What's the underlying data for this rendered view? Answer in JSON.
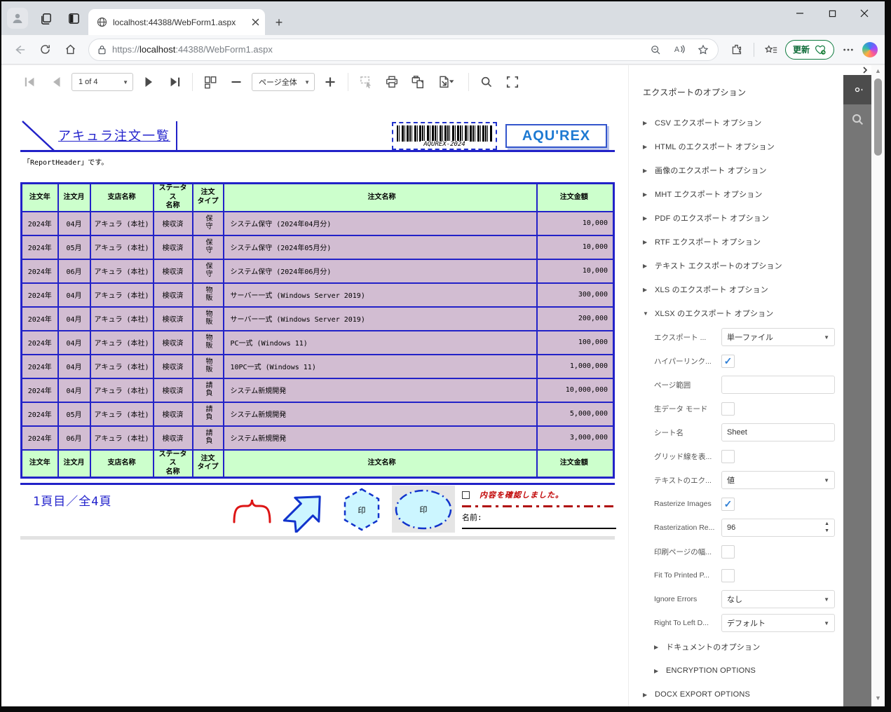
{
  "browser": {
    "tab_title": "localhost:44388/WebForm1.aspx",
    "url_scheme": "https://",
    "url_host": "localhost",
    "url_rest": ":44388/WebForm1.aspx",
    "update_label": "更新",
    "new_tab_glyph": "+",
    "minimize_glyph": "–",
    "close_glyph": "×"
  },
  "viewer_toolbar": {
    "page_indicator": "1 of 4",
    "zoom_mode": "ページ全体"
  },
  "report": {
    "title": "アキュラ注文一覧",
    "barcode_label": "AQUREX-2024",
    "logo_text": "AQU'REX",
    "header_note": "「ReportHeader」です。",
    "footer_page_text": "1頁目／全4頁",
    "stamp_text": "印",
    "confirm_text": "内容を確認しました。",
    "name_label": "名前:"
  },
  "table": {
    "headers": {
      "year": "注文年",
      "month": "注文月",
      "branch": "支店名称",
      "status": "ステータス\n名称",
      "type": "注文\nタイプ",
      "name": "注文名称",
      "amount": "注文金額"
    },
    "rows": [
      {
        "year": "2024年",
        "month": "04月",
        "branch": "アキュラ (本社)",
        "status": "検収済",
        "type": "保守",
        "name": "システム保守 (2024年04月分)",
        "amount": "10,000"
      },
      {
        "year": "2024年",
        "month": "05月",
        "branch": "アキュラ (本社)",
        "status": "検収済",
        "type": "保守",
        "name": "システム保守 (2024年05月分)",
        "amount": "10,000"
      },
      {
        "year": "2024年",
        "month": "06月",
        "branch": "アキュラ (本社)",
        "status": "検収済",
        "type": "保守",
        "name": "システム保守 (2024年06月分)",
        "amount": "10,000"
      },
      {
        "year": "2024年",
        "month": "04月",
        "branch": "アキュラ (本社)",
        "status": "検収済",
        "type": "物販",
        "name": "サーバー一式 (Windows Server 2019)",
        "amount": "300,000"
      },
      {
        "year": "2024年",
        "month": "04月",
        "branch": "アキュラ (本社)",
        "status": "検収済",
        "type": "物販",
        "name": "サーバー一式 (Windows Server 2019)",
        "amount": "200,000"
      },
      {
        "year": "2024年",
        "month": "04月",
        "branch": "アキュラ (本社)",
        "status": "検収済",
        "type": "物販",
        "name": "PC一式 (Windows 11)",
        "amount": "100,000"
      },
      {
        "year": "2024年",
        "month": "04月",
        "branch": "アキュラ (本社)",
        "status": "検収済",
        "type": "物販",
        "name": "10PC一式 (Windows 11)",
        "amount": "1,000,000"
      },
      {
        "year": "2024年",
        "month": "04月",
        "branch": "アキュラ (本社)",
        "status": "検収済",
        "type": "請負",
        "name": "システム新規開発",
        "amount": "10,000,000"
      },
      {
        "year": "2024年",
        "month": "05月",
        "branch": "アキュラ (本社)",
        "status": "検収済",
        "type": "請負",
        "name": "システム新規開発",
        "amount": "5,000,000"
      },
      {
        "year": "2024年",
        "month": "06月",
        "branch": "アキュラ (本社)",
        "status": "検収済",
        "type": "請負",
        "name": "システム新規開発",
        "amount": "3,000,000"
      }
    ]
  },
  "sidebar": {
    "title": "エクスポートのオプション",
    "sections": [
      {
        "label": "CSV エクスポート オプション"
      },
      {
        "label": "HTML のエクスポート オプション"
      },
      {
        "label": "画像のエクスポート オプション"
      },
      {
        "label": "MHT エクスポート オプション"
      },
      {
        "label": "PDF のエクスポート オプション"
      },
      {
        "label": "RTF エクスポート オプション"
      },
      {
        "label": "テキスト エクスポートのオプション"
      },
      {
        "label": "XLS のエクスポート オプション"
      }
    ],
    "xlsx": {
      "label": "XLSX のエクスポート オプション",
      "export_mode": {
        "label": "エクスポート ...",
        "value": "単一ファイル"
      },
      "hyperlink": {
        "label": "ハイパーリンク...",
        "mark": "✓"
      },
      "page_range": {
        "label": "ページ範囲",
        "value": ""
      },
      "raw_data": {
        "label": "生データ モード",
        "mark": ""
      },
      "sheet_name": {
        "label": "シート名",
        "value": "Sheet"
      },
      "gridlines": {
        "label": "グリッド線を表...",
        "mark": ""
      },
      "text_export": {
        "label": "テキストのエク...",
        "value": "値"
      },
      "rasterize": {
        "label": "Rasterize Images",
        "mark": "✓"
      },
      "raster_res": {
        "label": "Rasterization Re...",
        "value": "96"
      },
      "print_width": {
        "label": "印刷ページの幅...",
        "mark": ""
      },
      "fit_printed": {
        "label": "Fit To Printed P...",
        "mark": ""
      },
      "ignore_errors": {
        "label": "Ignore Errors",
        "value": "なし"
      },
      "rtl": {
        "label": "Right To Left D...",
        "value": "デフォルト"
      }
    },
    "sub_sections": [
      {
        "label": "ドキュメントのオプション"
      },
      {
        "label": "ENCRYPTION OPTIONS"
      }
    ],
    "bottom_sections": [
      {
        "label": "DOCX EXPORT OPTIONS"
      }
    ],
    "colors": {
      "accent_blue": "#2222c8",
      "header_green": "#ccffcc",
      "row_mauve": "#d2bdd2",
      "check_blue": "#2f7fd6"
    }
  }
}
